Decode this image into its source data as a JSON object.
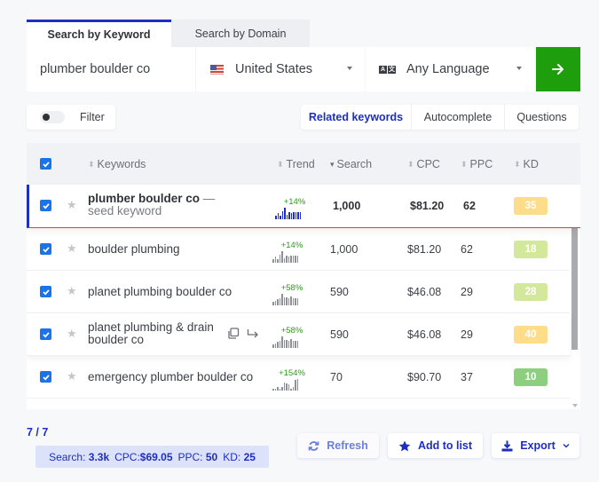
{
  "tabs": {
    "keyword": "Search by Keyword",
    "domain": "Search by Domain"
  },
  "search": {
    "keyword": "plumber boulder co",
    "country": "United States",
    "language": "Any Language",
    "language_icon_letters": [
      "A",
      "文"
    ]
  },
  "filter": {
    "label": "Filter",
    "enabled": false
  },
  "modes": [
    {
      "label": "Related keywords",
      "active": true
    },
    {
      "label": "Autocomplete",
      "active": false
    },
    {
      "label": "Questions",
      "active": false
    }
  ],
  "table": {
    "columns": {
      "keywords": "Keywords",
      "trend": "Trend",
      "search": "Search",
      "cpc": "CPC",
      "ppc": "PPC",
      "kd": "KD"
    },
    "sorted_by": "Search",
    "rows": [
      {
        "keyword": "plumber boulder co",
        "seed_note": "— seed keyword",
        "seed": true,
        "checked": true,
        "trend_pct": "+14%",
        "trend": [
          3,
          5,
          3,
          7,
          10,
          4,
          6,
          5,
          6,
          6,
          6,
          6
        ],
        "search": "1,000",
        "cpc": "$81.20",
        "ppc": "62",
        "kd": "35",
        "kd_color": "#fddc8a"
      },
      {
        "keyword": "boulder plumbing",
        "checked": true,
        "trend_pct": "+14%",
        "trend": [
          3,
          5,
          3,
          7,
          10,
          4,
          6,
          5,
          6,
          6,
          6,
          6
        ],
        "search": "1,000",
        "cpc": "$81.20",
        "ppc": "62",
        "kd": "18",
        "kd_color": "#d3e89a"
      },
      {
        "keyword": "planet plumbing boulder co",
        "checked": true,
        "trend_pct": "+58%",
        "trend": [
          3,
          4,
          5,
          6,
          10,
          7,
          7,
          6,
          8,
          6,
          6,
          6
        ],
        "search": "590",
        "cpc": "$46.08",
        "ppc": "29",
        "kd": "28",
        "kd_color": "#d3e89a"
      },
      {
        "keyword": "planet plumbing & drain boulder co",
        "checked": true,
        "hover_actions": [
          "copy-icon",
          "open-icon"
        ],
        "trend_pct": "+58%",
        "trend": [
          3,
          4,
          5,
          6,
          10,
          7,
          7,
          6,
          8,
          6,
          6,
          6
        ],
        "search": "590",
        "cpc": "$46.08",
        "ppc": "29",
        "kd": "40",
        "kd_color": "#fddc8a"
      },
      {
        "keyword": "emergency plumber boulder co",
        "checked": true,
        "trend_pct": "+154%",
        "trend": [
          1,
          1,
          3,
          2,
          3,
          8,
          7,
          6,
          2,
          3,
          10,
          11
        ],
        "search": "70",
        "cpc": "$90.70",
        "ppc": "37",
        "kd": "10",
        "kd_color": "#8ccf7e"
      }
    ]
  },
  "footer": {
    "count": "7 / 7",
    "summary": {
      "search_label": "Search:",
      "search_value": "3.3k",
      "cpc_label": "CPC:",
      "cpc_value": "$69.05",
      "ppc_label": "PPC:",
      "ppc_value": "50",
      "kd_label": "KD:",
      "kd_value": "25"
    },
    "buttons": {
      "refresh": "Refresh",
      "add_to_list": "Add to list",
      "export": "Export"
    }
  },
  "colors": {
    "accent": "#1d2ec2",
    "go_button": "#1e9e0d",
    "trend_positive": "#2e9b1a",
    "checkbox": "#1a73e8"
  }
}
